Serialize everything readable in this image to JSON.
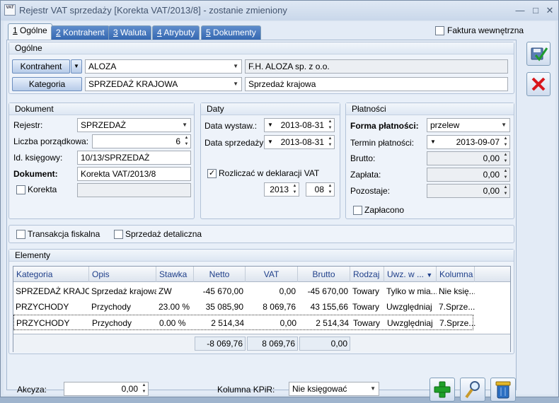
{
  "window": {
    "title": "Rejestr VAT sprzedaży [Korekta VAT/2013/8] - zostanie zmieniony",
    "icon_text": "VAT"
  },
  "tabs": [
    {
      "key": "1",
      "label": " Ogólne"
    },
    {
      "key": "2",
      "label": " Kontrahent"
    },
    {
      "key": "3",
      "label": " Waluta"
    },
    {
      "key": "4",
      "label": " Atrybuty"
    },
    {
      "key": "5",
      "label": " Dokumenty"
    }
  ],
  "faktura_wewnetrzna": "Faktura wewnętrzna",
  "ogolne": {
    "title": "Ogólne",
    "kontrahent_btn": "Kontrahent",
    "kontrahent_value": "ALOZA",
    "kontrahent_name": "F.H. ALOZA sp. z o.o.",
    "kategoria_btn": "Kategoria",
    "kategoria_value": "SPRZEDAŻ KRAJOWA",
    "kategoria_desc": "Sprzedaż krajowa"
  },
  "dokument": {
    "title": "Dokument",
    "rejestr_label": "Rejestr:",
    "rejestr_value": "SPRZEDAŻ",
    "lp_label": "Liczba porządkowa:",
    "lp_value": "6",
    "id_label": "Id. księgowy:",
    "id_value": "10/13/SPRZEDAŻ",
    "dok_label": "Dokument:",
    "dok_value": "Korekta VAT/2013/8",
    "korekta_label": "Korekta"
  },
  "daty": {
    "title": "Daty",
    "wystaw_label": "Data wystaw.:",
    "wystaw_value": "2013-08-31",
    "sprzed_label": "Data sprzedaży:",
    "sprzed_value": "2013-08-31",
    "rozliczac_label": "Rozliczać w deklaracji VAT",
    "rok": "2013",
    "miesiac": "08"
  },
  "platnosci": {
    "title": "Płatności",
    "forma_label": "Forma płatności:",
    "forma_value": "przelew",
    "termin_label": "Termin płatności:",
    "termin_value": "2013-09-07",
    "brutto_label": "Brutto:",
    "brutto_value": "0,00",
    "zaplata_label": "Zapłata:",
    "zaplata_value": "0,00",
    "pozostaje_label": "Pozostaje:",
    "pozostaje_value": "0,00",
    "zaplacono_label": "Zapłacono"
  },
  "transakcja_fiskalna": "Transakcja fiskalna",
  "sprzedaz_detaliczna": "Sprzedaż detaliczna",
  "elementy": {
    "title": "Elementy",
    "columns": [
      "Kategoria",
      "Opis",
      "Stawka",
      "Netto",
      "VAT",
      "Brutto",
      "Rodzaj",
      "Uwz. w ...",
      "Kolumna"
    ],
    "rows": [
      [
        "SPRZEDAŻ KRAJO...",
        "Sprzedaż krajowa",
        "ZW",
        "-45 670,00",
        "0,00",
        "-45 670,00",
        "Towary",
        "Tylko w mia...",
        "Nie księ..."
      ],
      [
        "PRZYCHODY",
        "Przychody",
        "23.00 %",
        "35 085,90",
        "8 069,76",
        "43 155,66",
        "Towary",
        "Uwzględniaj",
        "7.Sprze..."
      ],
      [
        "PRZYCHODY",
        "Przychody",
        "0.00  %",
        "2 514,34",
        "0,00",
        "2 514,34",
        "Towary",
        "Uwzględniaj",
        "7.Sprze..."
      ]
    ],
    "sum_netto": "-8 069,76",
    "sum_vat": "8 069,76",
    "sum_brutto": "0,00"
  },
  "akcyza_label": "Akcyza:",
  "akcyza_value": "0,00",
  "kolumna_label": "Kolumna KPiR:",
  "kolumna_value": "Nie księgować"
}
